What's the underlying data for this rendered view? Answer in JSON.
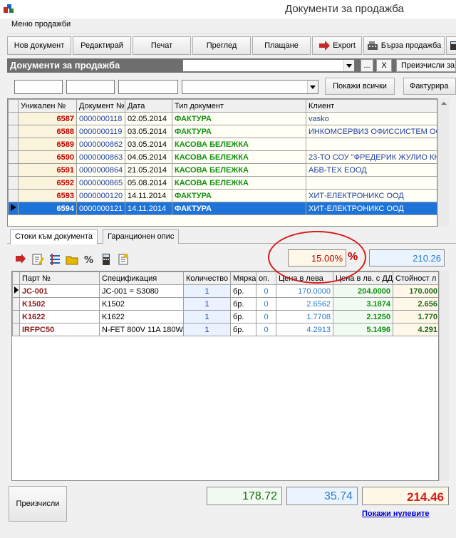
{
  "window": {
    "title": "Документи за продажба"
  },
  "menu": {
    "sales_docs": "Меню продажби"
  },
  "toolbar": {
    "new_doc": "Нов документ",
    "edit": "Редактирай",
    "print": "Печат",
    "preview": "Преглед",
    "payment": "Плащане",
    "export": "Export",
    "quick_sale": "Бърза продажба"
  },
  "header": {
    "title": "Документи за продажба",
    "dots_label": "...",
    "close_label": "X",
    "recalc_label": "Преизчисли за"
  },
  "filter": {
    "show_all": "Покажи всички",
    "invoice": "Фактурира"
  },
  "docs_table": {
    "columns": [
      "Уникален №",
      "Документ №",
      "Дата",
      "Тип документ",
      "Клиент"
    ],
    "rows": [
      {
        "uid": "6587",
        "doc": "0000000118",
        "date": "02.05.2014",
        "type": "ФАКТУРА",
        "client": "vasko"
      },
      {
        "uid": "6588",
        "doc": "0000000119",
        "date": "03.05.2014",
        "type": "ФАКТУРА",
        "client": "ИНКОМСЕРВИЗ ОФИССИСТЕМ ОО"
      },
      {
        "uid": "6589",
        "doc": "0000000862",
        "date": "03.05.2014",
        "type": "КАСОВА БЕЛЕЖКА",
        "client": ""
      },
      {
        "uid": "6590",
        "doc": "0000000863",
        "date": "04.05.2014",
        "type": "КАСОВА БЕЛЕЖКА",
        "client": "23-ТО СОУ \"ФРЕДЕРИК ЖУЛИО КЮ"
      },
      {
        "uid": "6591",
        "doc": "0000000864",
        "date": "21.05.2014",
        "type": "КАСОВА БЕЛЕЖКА",
        "client": "АБВ-ТЕХ ЕООД"
      },
      {
        "uid": "6592",
        "doc": "0000000865",
        "date": "05.08.2014",
        "type": "КАСОВА БЕЛЕЖКА",
        "client": ""
      },
      {
        "uid": "6593",
        "doc": "0000000120",
        "date": "14.11.2014",
        "type": "ФАКТУРА",
        "client": "ХИТ-ЕЛЕКТРОНИКС ООД"
      },
      {
        "uid": "6594",
        "doc": "0000000121",
        "date": "14.11.2014",
        "type": "ФАКТУРА",
        "client": "ХИТ-ЕЛЕКТРОНИКС ООД"
      }
    ]
  },
  "tabs": {
    "items": "Стоки към документа",
    "warranty": "Гаранционен опис"
  },
  "pricing": {
    "percent": "15.00%",
    "percent_sign": "%",
    "value": "210.26"
  },
  "items_table": {
    "columns": [
      "Парт №",
      "Спецификация",
      "Количество",
      "Мярка",
      "оп.",
      "Цена в лева",
      "Цена в лв. с ДДС",
      "Стойност л"
    ],
    "rows": [
      {
        "part": "JC-001",
        "spec": "JC-001 = S3080",
        "qty": "1",
        "unit": "бр.",
        "op": "0",
        "price": "170.0000",
        "price_vat": "204.0000",
        "total": "170.000"
      },
      {
        "part": "K1502",
        "spec": "K1502",
        "qty": "1",
        "unit": "бр.",
        "op": "0",
        "price": "2.6562",
        "price_vat": "3.1874",
        "total": "2.656"
      },
      {
        "part": "K1622",
        "spec": "K1622",
        "qty": "1",
        "unit": "бр.",
        "op": "0",
        "price": "1.7708",
        "price_vat": "2.1250",
        "total": "1.770"
      },
      {
        "part": "IRFPC50",
        "spec": "N-FET 800V 11A 180W",
        "qty": "1",
        "unit": "бр.",
        "op": "0",
        "price": "4.2913",
        "price_vat": "5.1496",
        "total": "4.291"
      }
    ]
  },
  "totals": {
    "recalc_button": "Преизчисли",
    "net": "178.72",
    "vat": "35.74",
    "gross": "214.46",
    "show_zero": "Покажи нулевите"
  },
  "colors": {
    "header_bg": "#6e6e6e",
    "selected_row": "#1e73d8",
    "invoice_green": "#139013",
    "uid_red": "#c00000",
    "highlight_circle": "#d51c1c"
  }
}
